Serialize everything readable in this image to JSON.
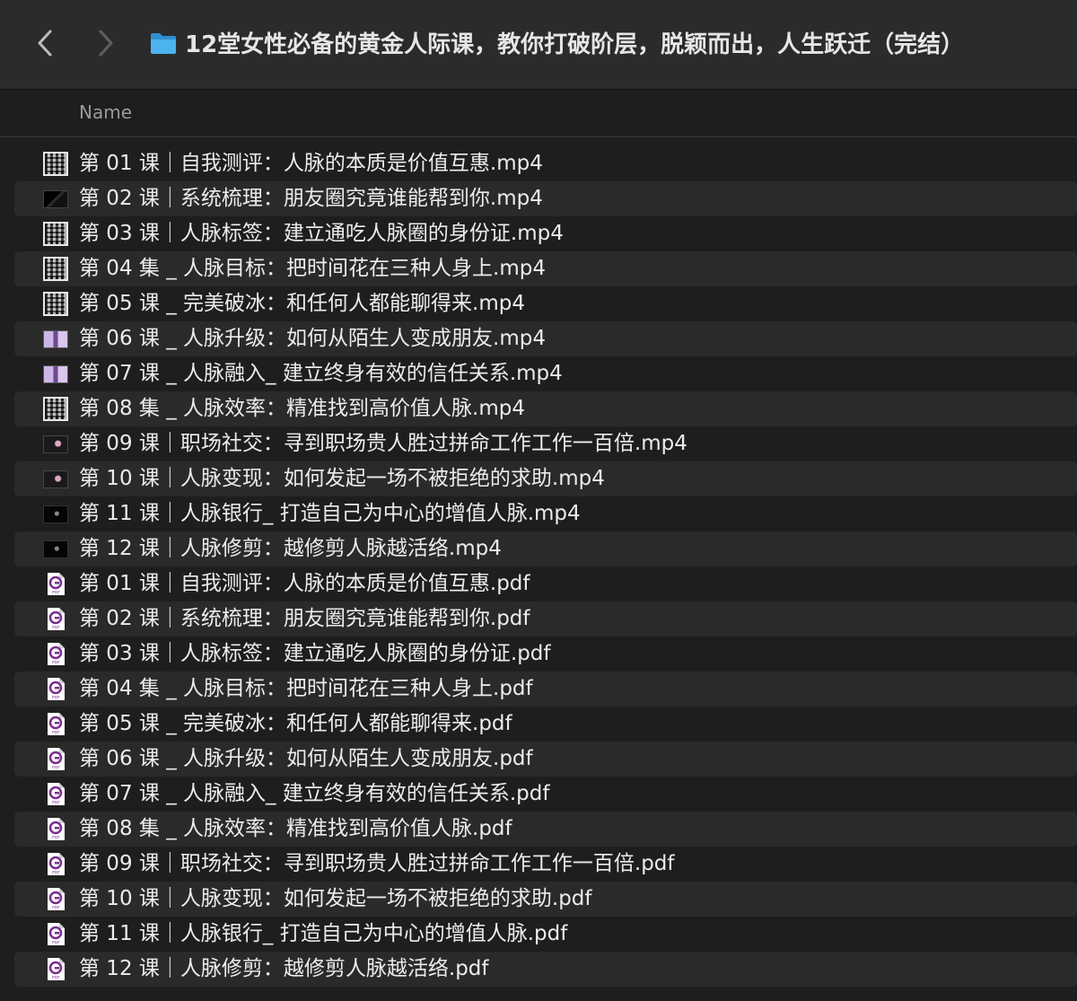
{
  "window": {
    "title": "12堂女性必备的黄金人际课，教你打破阶层，脱颖而出，人生跃迁（完结）"
  },
  "navigation": {
    "back_icon": "chevron-left-icon",
    "forward_icon": "chevron-right-icon"
  },
  "columns": {
    "name": "Name"
  },
  "colors": {
    "background": "#1e1e1f",
    "toolbar": "#2b2b2c",
    "row_alt": "#2a2a2b",
    "text": "#ececec",
    "folder_accent": "#3aa7e8",
    "pdf_accent": "#7a2f8f"
  },
  "files": [
    {
      "name": "第 01 课｜自我测评：人脉的本质是价值互惠.mp4",
      "icon": "qr-thumbnail"
    },
    {
      "name": "第 02 课｜系统梳理：朋友圈究竟谁能帮到你.mp4",
      "icon": "black-thumbnail"
    },
    {
      "name": "第 03 课｜人脉标签：建立通吃人脉圈的身份证.mp4",
      "icon": "qr-thumbnail"
    },
    {
      "name": "第 04 集 _ 人脉目标：把时间花在三种人身上.mp4",
      "icon": "qr-thumbnail"
    },
    {
      "name": "第 05 课 _ 完美破冰：和任何人都能聊得来.mp4",
      "icon": "qr-thumbnail"
    },
    {
      "name": "第 06 课 _ 人脉升级：如何从陌生人变成朋友.mp4",
      "icon": "purple-thumbnail"
    },
    {
      "name": "第 07 课 _ 人脉融入_ 建立终身有效的信任关系.mp4",
      "icon": "purple-thumbnail"
    },
    {
      "name": "第 08 集 _ 人脉效率：精准找到高价值人脉.mp4",
      "icon": "qr-thumbnail"
    },
    {
      "name": "第 09 课｜职场社交：寻到职场贵人胜过拼命工作工作一百倍.mp4",
      "icon": "dark-thumbnail"
    },
    {
      "name": "第 10 课｜人脉变现：如何发起一场不被拒绝的求助.mp4",
      "icon": "dark-thumbnail"
    },
    {
      "name": "第 11 课｜人脉银行_ 打造自己为中心的增值人脉.mp4",
      "icon": "night-thumbnail"
    },
    {
      "name": "第 12 课｜人脉修剪：越修剪人脉越活络.mp4",
      "icon": "night-thumbnail"
    },
    {
      "name": "第 01 课｜自我测评：人脉的本质是价值互惠.pdf",
      "icon": "pdf-icon"
    },
    {
      "name": "第 02 课｜系统梳理：朋友圈究竟谁能帮到你.pdf",
      "icon": "pdf-icon"
    },
    {
      "name": "第 03 课｜人脉标签：建立通吃人脉圈的身份证.pdf",
      "icon": "pdf-icon"
    },
    {
      "name": "第 04 集 _ 人脉目标：把时间花在三种人身上.pdf",
      "icon": "pdf-icon"
    },
    {
      "name": "第 05 课 _ 完美破冰：和任何人都能聊得来.pdf",
      "icon": "pdf-icon"
    },
    {
      "name": "第 06 课 _ 人脉升级：如何从陌生人变成朋友.pdf",
      "icon": "pdf-icon"
    },
    {
      "name": "第 07 课 _ 人脉融入_ 建立终身有效的信任关系.pdf",
      "icon": "pdf-icon"
    },
    {
      "name": "第 08 集 _ 人脉效率：精准找到高价值人脉.pdf",
      "icon": "pdf-icon"
    },
    {
      "name": "第 09 课｜职场社交：寻到职场贵人胜过拼命工作工作一百倍.pdf",
      "icon": "pdf-icon"
    },
    {
      "name": "第 10 课｜人脉变现：如何发起一场不被拒绝的求助.pdf",
      "icon": "pdf-icon"
    },
    {
      "name": "第 11 课｜人脉银行_ 打造自己为中心的增值人脉.pdf",
      "icon": "pdf-icon"
    },
    {
      "name": "第 12 课｜人脉修剪：越修剪人脉越活络.pdf",
      "icon": "pdf-icon"
    }
  ]
}
